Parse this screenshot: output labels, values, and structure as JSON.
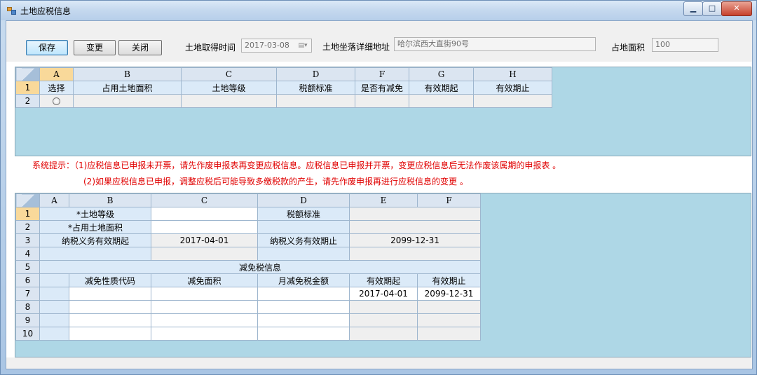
{
  "window": {
    "title": "土地应税信息",
    "controls": {
      "min": "▁",
      "max": "□",
      "close": "✕"
    }
  },
  "toolbar": {
    "save_label": "保存",
    "change_label": "变更",
    "close_label": "关闭",
    "acq_date_label": "土地取得时间",
    "acq_date_value": "2017-03-08",
    "address_label": "土地坐落详细地址",
    "address_value": "哈尔滨西大直街90号",
    "area_label": "占地面积",
    "area_value": "100"
  },
  "grid1": {
    "col_headers": [
      "A",
      "B",
      "C",
      "D",
      "F",
      "G",
      "H"
    ],
    "row_headers": [
      "1",
      "2"
    ],
    "header_row": [
      "选择",
      "占用土地面积",
      "土地等级",
      "税额标准",
      "是否有减免",
      "有效期起",
      "有效期止"
    ]
  },
  "hints": {
    "line1": "系统提示：（1)应税信息已申报未开票，请先作废申报表再变更应税信息。应税信息已申报并开票，变更应税信息后无法作废该属期的申报表 。",
    "line2": "(2)如果应税信息已申报，调整应税后可能导致多缴税款的产生，请先作废申报再进行应税信息的变更 。"
  },
  "grid2": {
    "col_headers": [
      "A",
      "B",
      "C",
      "D",
      "E",
      "F"
    ],
    "row_headers": [
      "1",
      "2",
      "3",
      "4",
      "5",
      "6",
      "7",
      "8",
      "9",
      "10"
    ],
    "land_grade_label": "*土地等级",
    "tax_std_label": "税额标准",
    "occupied_area_label": "*占用土地面积",
    "valid_from_label": "纳税义务有效期起",
    "valid_from_value": "2017-04-01",
    "valid_to_label": "纳税义务有效期止",
    "valid_to_value": "2099-12-31",
    "section_title": "减免税信息",
    "sub_headers": [
      "减免性质代码",
      "减免面积",
      "月减免税金额",
      "有效期起",
      "有效期止"
    ],
    "row7_from": "2017-04-01",
    "row7_to": "2099-12-31"
  }
}
